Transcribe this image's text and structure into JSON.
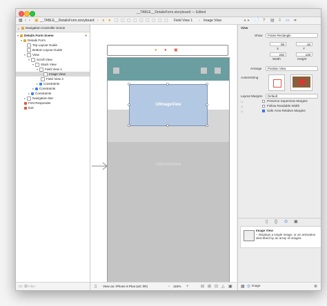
{
  "window": {
    "title": "__TABLE__DetailsForm.storyboard — Edited"
  },
  "jump_bar": {
    "crumbs": [
      "__TABLE__DetailsForm.storyboard",
      "Field View 1",
      "Image View"
    ]
  },
  "navigator": {
    "header": "Navigation Controller Scene",
    "items": [
      {
        "label": "Details Form Scene",
        "level": 0,
        "bold": true
      },
      {
        "label": "Details Form",
        "level": 1
      },
      {
        "label": "Top Layout Guide",
        "level": 2
      },
      {
        "label": "Bottom Layout Guide",
        "level": 2
      },
      {
        "label": "View",
        "level": 2
      },
      {
        "label": "Scroll View",
        "level": 3
      },
      {
        "label": "Stack View",
        "level": 4
      },
      {
        "label": "Field View 1",
        "level": 5
      },
      {
        "label": "Image View",
        "level": 6,
        "selected": true
      },
      {
        "label": "Field View 2",
        "level": 5
      },
      {
        "label": "Constraints",
        "level": 4
      },
      {
        "label": "Constraints",
        "level": 3
      },
      {
        "label": "Constraints",
        "level": 2
      },
      {
        "label": "Navigation Bar",
        "level": 1
      },
      {
        "label": "First Responder",
        "level": 1
      },
      {
        "label": "Exit",
        "level": 1
      }
    ],
    "filter_placeholder": "Filter"
  },
  "canvas": {
    "image_view_label": "UIImageView",
    "lower_label": "UIScrollView",
    "view_as": "View as: iPhone 8 Plus (wC hR)",
    "zoom": "115%"
  },
  "inspector": {
    "section": "View",
    "show_label": "Show",
    "show_value": "Frame Rectangle",
    "x": "59",
    "y": "-16",
    "x_label": "X",
    "y_label": "Y",
    "width": "240",
    "height": "128",
    "width_label": "Width",
    "height_label": "Height",
    "arrange_label": "Arrange",
    "arrange_value": "Position View",
    "autoresizing_label": "Autoresizing",
    "layout_margins_label": "Layout Margins",
    "layout_margins_value": "Default",
    "checkboxes": [
      {
        "label": "Preserve Superview Margins",
        "checked": false
      },
      {
        "label": "Follow Readable Width",
        "checked": false
      },
      {
        "label": "Safe Area Relative Margins",
        "checked": true
      }
    ],
    "library_title": "Image View",
    "library_desc": "– Displays a single image, or an animation described by an array of images.",
    "library_filter": "image"
  }
}
